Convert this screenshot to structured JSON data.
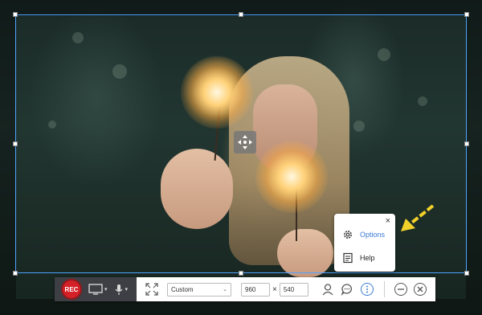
{
  "popup": {
    "close": "×",
    "items": [
      {
        "label": "Options",
        "icon": "gear-icon"
      },
      {
        "label": "Help",
        "icon": "help-doc-icon"
      }
    ]
  },
  "toolbar": {
    "rec_label": "REC",
    "screen_icon": "monitor-icon",
    "mic_icon": "microphone-icon",
    "fullscreen_icon": "expand-arrows-icon",
    "region_preset": "Custom",
    "width_value": "960",
    "times_sign": "×",
    "height_value": "540",
    "webcam_icon": "user-icon",
    "chat_icon": "speech-bubble-icon",
    "more_icon": "vertical-dots-icon",
    "minimize_icon": "minus-icon",
    "close_icon": "close-icon"
  },
  "colors": {
    "rec": "#d42027",
    "frame": "#4fa3ff",
    "arrow": "#f2d02a",
    "options_text": "#3a7bd5"
  }
}
